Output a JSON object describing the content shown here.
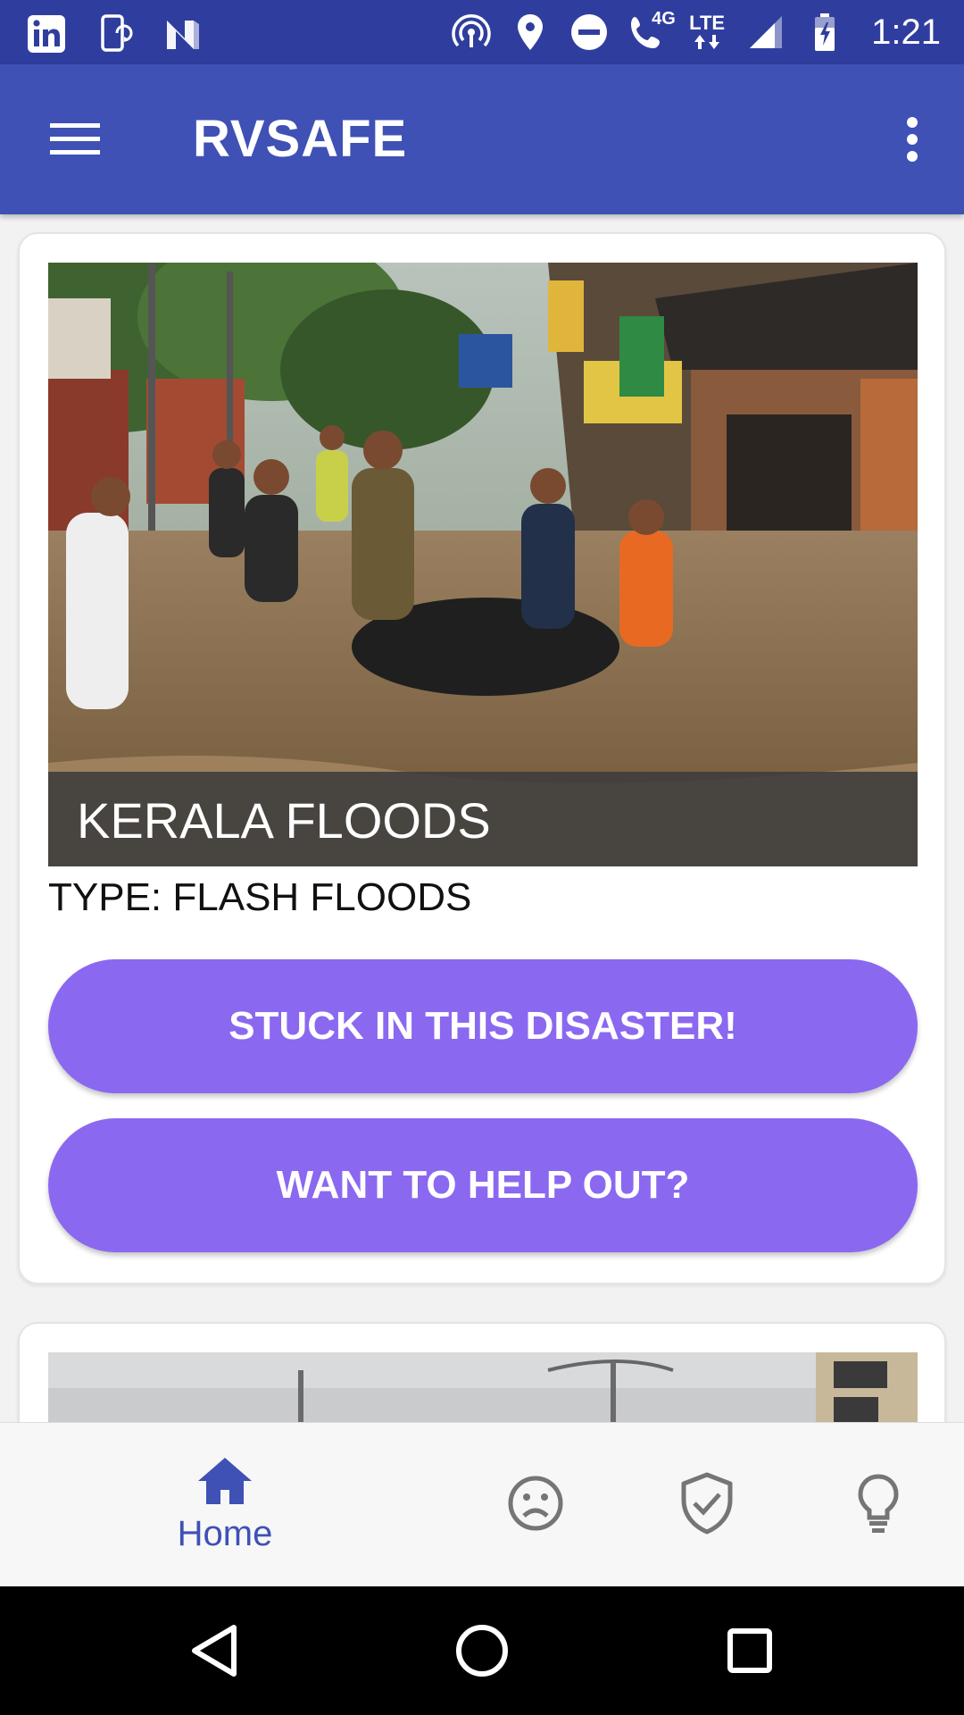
{
  "status_bar": {
    "time": "1:21",
    "network_label": "LTE",
    "call_label": "4G",
    "icons": [
      "linkedin-icon",
      "phone-sync-icon",
      "n-app-icon",
      "hotspot-icon",
      "location-icon",
      "do-not-disturb-icon",
      "wifi-call-icon",
      "lte-data-icon",
      "signal-icon",
      "battery-charging-icon"
    ]
  },
  "app_bar": {
    "title": "RVSAFE",
    "menu_icon": "hamburger-menu-icon",
    "overflow_icon": "more-vert-icon"
  },
  "cards": [
    {
      "image_caption": "KERALA FLOODS",
      "type_text": "TYPE: FLASH FLOODS",
      "buttons": {
        "stuck": "STUCK IN THIS DISASTER!",
        "help": "WANT TO HELP OUT?"
      }
    }
  ],
  "bottom_nav": {
    "items": [
      {
        "label": "Home",
        "icon": "home-icon",
        "active": true
      },
      {
        "label": "",
        "icon": "sad-face-icon",
        "active": false
      },
      {
        "label": "",
        "icon": "shield-check-icon",
        "active": false
      },
      {
        "label": "",
        "icon": "lightbulb-icon",
        "active": false
      }
    ]
  },
  "system_nav": {
    "icons": [
      "back-icon",
      "home-circle-icon",
      "recents-icon"
    ]
  },
  "colors": {
    "status_bar": "#2f3e9e",
    "app_bar": "#3f51b5",
    "button": "#8b68f0",
    "nav_active": "#3f51b5",
    "nav_inactive": "#757575"
  }
}
